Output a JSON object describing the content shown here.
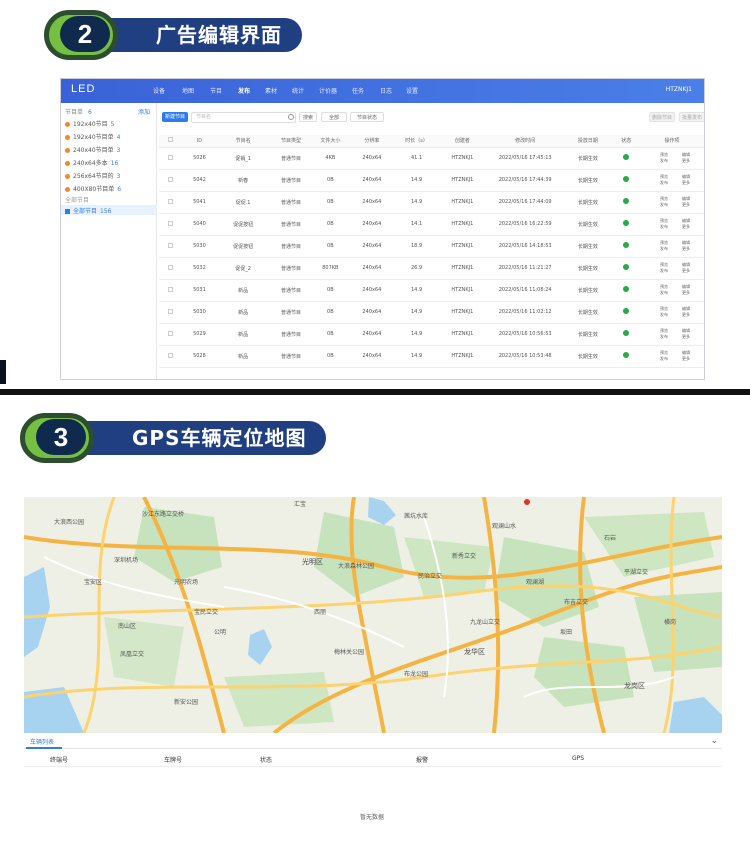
{
  "section2": {
    "number": "2",
    "title": "广告编辑界面",
    "app": {
      "logo": "LED",
      "nav": [
        "设备",
        "地图",
        "节目",
        "发布",
        "素材",
        "统计",
        "计价器",
        "任务",
        "日志",
        "设置"
      ],
      "active_nav": "发布",
      "user": "HTZNKJ1",
      "sidebar": {
        "header": "节目单",
        "header_count": "6",
        "add": "添加",
        "items": [
          {
            "label": "192x40节目",
            "count": "5"
          },
          {
            "label": "192x40节目单",
            "count": "4"
          },
          {
            "label": "240x40节目单",
            "count": "3"
          },
          {
            "label": "240x64多本",
            "count": "16"
          },
          {
            "label": "256x64节目的",
            "count": "3"
          },
          {
            "label": "400X80节目单",
            "count": "6"
          }
        ],
        "all_label": "全部节目",
        "selected_label": "全部节目",
        "selected_count": "156"
      },
      "toolbar": {
        "new_button": "新建节目",
        "search_placeholder": "节目名",
        "search_button": "搜索",
        "filter1": "全部",
        "filter2": "节目状态",
        "right_btn1": "删除节目",
        "right_btn2": "批量发布"
      },
      "columns": [
        "",
        "ID",
        "节目名",
        "节目类型",
        "文件大小",
        "分辨率",
        "时长（s）",
        "创建者",
        "修改时间",
        "投放日期",
        "状态",
        "操作项"
      ],
      "rows": [
        [
          "",
          "5026",
          "促销_1",
          "普通节目",
          "4KB",
          "240x64",
          "41.1",
          "HTZNKJ1",
          "2022/05/16 17:45:13",
          "长期生效"
        ],
        [
          "",
          "5042",
          "新春",
          "普通节目",
          "0B",
          "240x64",
          "14.9",
          "HTZNKJ1",
          "2022/05/16 17:44:39",
          "长期生效"
        ],
        [
          "",
          "5041",
          "促促.1",
          "普通节目",
          "0B",
          "240x64",
          "14.9",
          "HTZNKJ1",
          "2022/05/16 17:44:09",
          "长期生效"
        ],
        [
          "",
          "5040",
          "促促按钮",
          "普通节目",
          "0B",
          "240x64",
          "14.1",
          "HTZNKJ1",
          "2022/05/16 16:22:59",
          "长期生效"
        ],
        [
          "",
          "5030",
          "促促按钮",
          "普通节目",
          "0B",
          "240x64",
          "18.9",
          "HTZNKJ1",
          "2022/05/16 14:18:53",
          "长期生效"
        ],
        [
          "",
          "5032",
          "促促_2",
          "普通节目",
          "807KB",
          "240x64",
          "26.9",
          "HTZNKJ1",
          "2022/05/16 11:21:27",
          "长期生效"
        ],
        [
          "",
          "5031",
          "新品",
          "普通节目",
          "0B",
          "240x64",
          "14.9",
          "HTZNKJ1",
          "2022/05/16 11:08:24",
          "长期生效"
        ],
        [
          "",
          "5030",
          "新品",
          "普通节目",
          "0B",
          "240x64",
          "14.9",
          "HTZNKJ1",
          "2022/05/16 11:02:12",
          "长期生效"
        ],
        [
          "",
          "5029",
          "新品",
          "普通节目",
          "0B",
          "240x64",
          "14.9",
          "HTZNKJ1",
          "2022/05/16 10:56:53",
          "长期生效"
        ],
        [
          "",
          "5028",
          "新品",
          "普通节目",
          "0B",
          "240x64",
          "14.9",
          "HTZNKJ1",
          "2022/05/16 10:53:48",
          "长期生效"
        ]
      ],
      "ops": {
        "preview": "预览",
        "edit": "编辑",
        "publish": "发布",
        "more": "更多"
      }
    }
  },
  "section3": {
    "number": "3",
    "title": "GPS车辆定位地图",
    "map_labels": [
      "沙江东路立交桥",
      "汇宝",
      "观澜山水",
      "宝安区",
      "大浪西公园",
      "光明区",
      "龙华区",
      "茜坑水库",
      "梅林关公园",
      "新秀立交",
      "深圳机场",
      "石岩",
      "公明",
      "坂田",
      "横岗",
      "龙岗区",
      "大浪森林公园",
      "平湖立交",
      "观澜湖",
      "布吉立交",
      "民治立交",
      "西丽",
      "凤凰立交",
      "新安公园",
      "南山区",
      "宝民立交",
      "光明农场",
      "九龙山立交",
      "布龙公园"
    ],
    "tab": "车辆列表",
    "collapse_icon": "chevron-down-icon",
    "columns": [
      "终端号",
      "车牌号",
      "状态",
      "报警",
      "GPS"
    ],
    "empty_text": "暂无数据"
  },
  "colors": {
    "banner_blue": "#1f3f80",
    "banner_green": "#75c043",
    "app_blue": "#3a62d8",
    "accent": "#2f7ce9",
    "ok_green": "#2aa84a"
  }
}
